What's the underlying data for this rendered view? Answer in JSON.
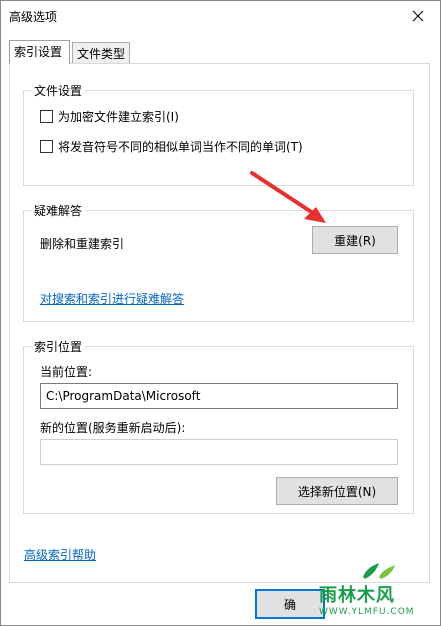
{
  "window": {
    "title": "高级选项"
  },
  "tabs": [
    {
      "label": "索引设置",
      "active": true
    },
    {
      "label": "文件类型",
      "active": false
    }
  ],
  "file_settings": {
    "legend": "文件设置",
    "checkboxes": [
      {
        "label": "为加密文件建立索引(I)",
        "checked": false
      },
      {
        "label": "将发音符号不同的相似单词当作不同的单词(T)",
        "checked": false
      }
    ]
  },
  "troubleshooting": {
    "legend": "疑难解答",
    "rebuild_label": "删除和重建索引",
    "rebuild_button": "重建(R)",
    "link": "对搜索和索引进行疑难解答"
  },
  "index_location": {
    "legend": "索引位置",
    "current_label": "当前位置:",
    "current_value": "C:\\ProgramData\\Microsoft",
    "new_label": "新的位置(服务重新启动后):",
    "new_value": "",
    "select_button": "选择新位置(N)"
  },
  "help_link": "高级索引帮助",
  "bottom": {
    "ok_label": "确"
  },
  "watermark": {
    "title": "雨林木风",
    "url": "WWW.YLMFU.COM"
  },
  "colors": {
    "link": "#0066cc",
    "arrow": "#e8312f",
    "focus": "#0078d7",
    "watermark": "#1a9e4c"
  }
}
